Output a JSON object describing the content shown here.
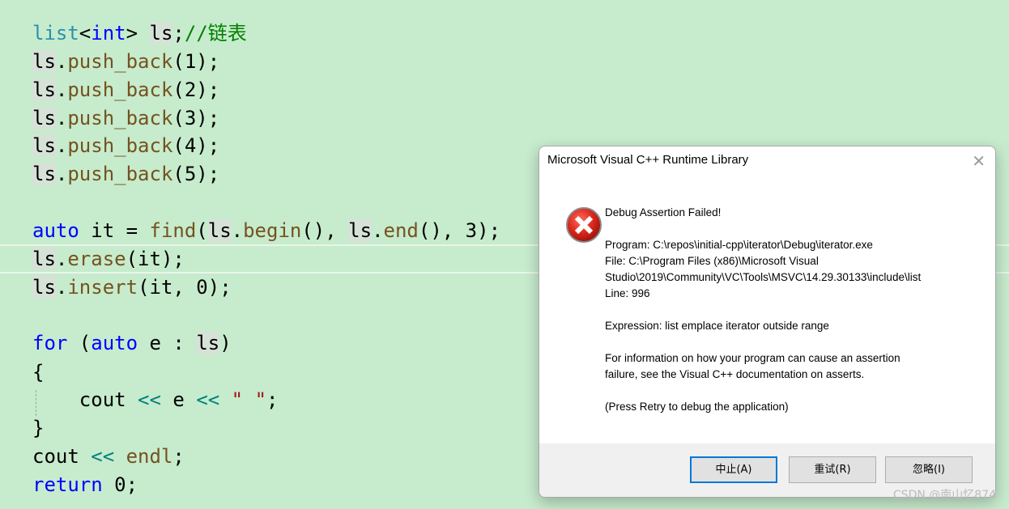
{
  "code": {
    "l1": {
      "t1": "list",
      "t2": "<",
      "t3": "int",
      "t4": "> ",
      "t5": "ls",
      "t6": ";",
      "t7": "//链表"
    },
    "l2": {
      "v": "ls",
      "dot": ".",
      "f": "push_back",
      "rest": "(1);"
    },
    "l3": {
      "v": "ls",
      "dot": ".",
      "f": "push_back",
      "rest": "(2);"
    },
    "l4": {
      "v": "ls",
      "dot": ".",
      "f": "push_back",
      "rest": "(3);"
    },
    "l5": {
      "v": "ls",
      "dot": ".",
      "f": "push_back",
      "rest": "(4);"
    },
    "l6": {
      "v": "ls",
      "dot": ".",
      "f": "push_back",
      "rest": "(5);"
    },
    "l7": {
      "kw": "auto",
      "a": " it = ",
      "f": "find",
      "b": "(",
      "v1": "ls",
      "dot1": ".",
      "f2": "begin",
      "c": "(), ",
      "v2": "ls",
      "dot2": ".",
      "f3": "end",
      "d": "(), 3);"
    },
    "l8": {
      "v": "ls",
      "dot": ".",
      "f": "erase",
      "rest": "(it);"
    },
    "l9": {
      "v": "ls",
      "dot": ".",
      "f": "insert",
      "rest": "(it, 0);"
    },
    "l10": {
      "kw1": "for",
      "a": " (",
      "kw2": "auto",
      "b": " e : ",
      "v": "ls",
      "c": ")"
    },
    "l11": "{",
    "l12": {
      "a": "    cout ",
      "op1": "<<",
      "b": " e ",
      "op2": "<<",
      "c": " ",
      "s": "\" \"",
      "d": ";"
    },
    "l13": "}",
    "l14": {
      "a": "cout ",
      "op": "<<",
      "b": " ",
      "f": "endl",
      "c": ";"
    },
    "l15": {
      "kw": "return",
      "a": " 0;"
    }
  },
  "dialog": {
    "title": "Microsoft Visual C++ Runtime Library",
    "close_glyph": "✕",
    "heading": "Debug Assertion Failed!",
    "program": "Program: C:\\repos\\initial-cpp\\iterator\\Debug\\iterator.exe",
    "file1": "File: C:\\Program Files (x86)\\Microsoft Visual",
    "file2": "Studio\\2019\\Community\\VC\\Tools\\MSVC\\14.29.30133\\include\\list",
    "line": "Line: 996",
    "expression": "Expression: list emplace iterator outside range",
    "info1": "For information on how your program can cause an assertion",
    "info2": "failure, see the Visual C++ documentation on asserts.",
    "press": "(Press Retry to debug the application)",
    "buttons": {
      "abort": "中止(A)",
      "retry": "重试(R)",
      "ignore": "忽略(I)"
    },
    "icon": "error-icon"
  },
  "watermark": "CSDN @南山忆874"
}
